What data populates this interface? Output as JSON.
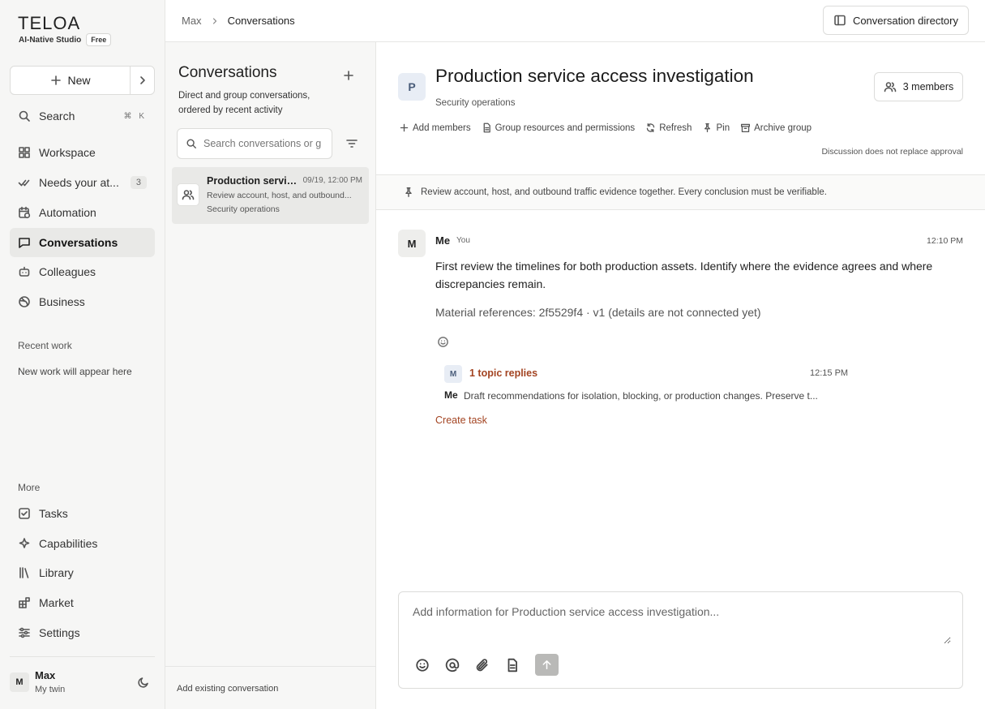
{
  "app": {
    "logo": "TELOA",
    "subtitle": "AI-Native Studio",
    "plan": "Free"
  },
  "sidebar": {
    "new_label": "New",
    "search": {
      "label": "Search",
      "shortcut": "⌘ K"
    },
    "items": [
      {
        "label": "Workspace"
      },
      {
        "label": "Needs your at...",
        "count": "3"
      },
      {
        "label": "Automation"
      },
      {
        "label": "Conversations"
      },
      {
        "label": "Colleagues"
      },
      {
        "label": "Business"
      }
    ],
    "recent_title": "Recent work",
    "recent_empty": "New work will appear here",
    "more_title": "More",
    "more_items": [
      {
        "label": "Tasks"
      },
      {
        "label": "Capabilities"
      },
      {
        "label": "Library"
      },
      {
        "label": "Market"
      },
      {
        "label": "Settings"
      }
    ],
    "user": {
      "initial": "M",
      "name": "Max",
      "sub": "My twin"
    }
  },
  "topbar": {
    "breadcrumb": [
      "Max",
      "Conversations"
    ],
    "directory_label": "Conversation directory"
  },
  "convlist": {
    "title": "Conversations",
    "description": "Direct and group conversations, ordered by recent activity",
    "search_placeholder": "Search conversations or g",
    "items": [
      {
        "title": "Production servic...",
        "date": "09/19, 12:00 PM",
        "preview": "Review account, host, and outbound...",
        "group": "Security operations"
      }
    ],
    "footer": "Add existing conversation"
  },
  "main": {
    "avatar": "P",
    "title": "Production service access investigation",
    "subtitle": "Security operations",
    "members_label": "3 members",
    "actions": {
      "add_members": "Add members",
      "resources": "Group resources and permissions",
      "refresh": "Refresh",
      "pin": "Pin",
      "archive": "Archive group"
    },
    "disclaimer": "Discussion does not replace approval",
    "pinned": "Review account, host, and outbound traffic evidence together. Every conclusion must be verifiable.",
    "message": {
      "avatar": "M",
      "author": "Me",
      "you_tag": "You",
      "time": "12:10 PM",
      "body": "First review the timelines for both production assets. Identify where the evidence agrees and where discrepancies remain.",
      "reference": "Material references: 2f5529f4 · v1 (details are not connected yet)",
      "thread": {
        "avatar": "M",
        "count_label": "1 topic replies",
        "time": "12:15 PM",
        "author": "Me",
        "text": "Draft recommendations for isolation, blocking, or production changes. Preserve t..."
      },
      "create_task": "Create task"
    },
    "composer": {
      "placeholder": "Add information for Production service access investigation..."
    }
  },
  "colors": {
    "accent": "#a34422",
    "sidebar_bg": "#f6f6f5",
    "active_bg": "#e9e9e7"
  }
}
